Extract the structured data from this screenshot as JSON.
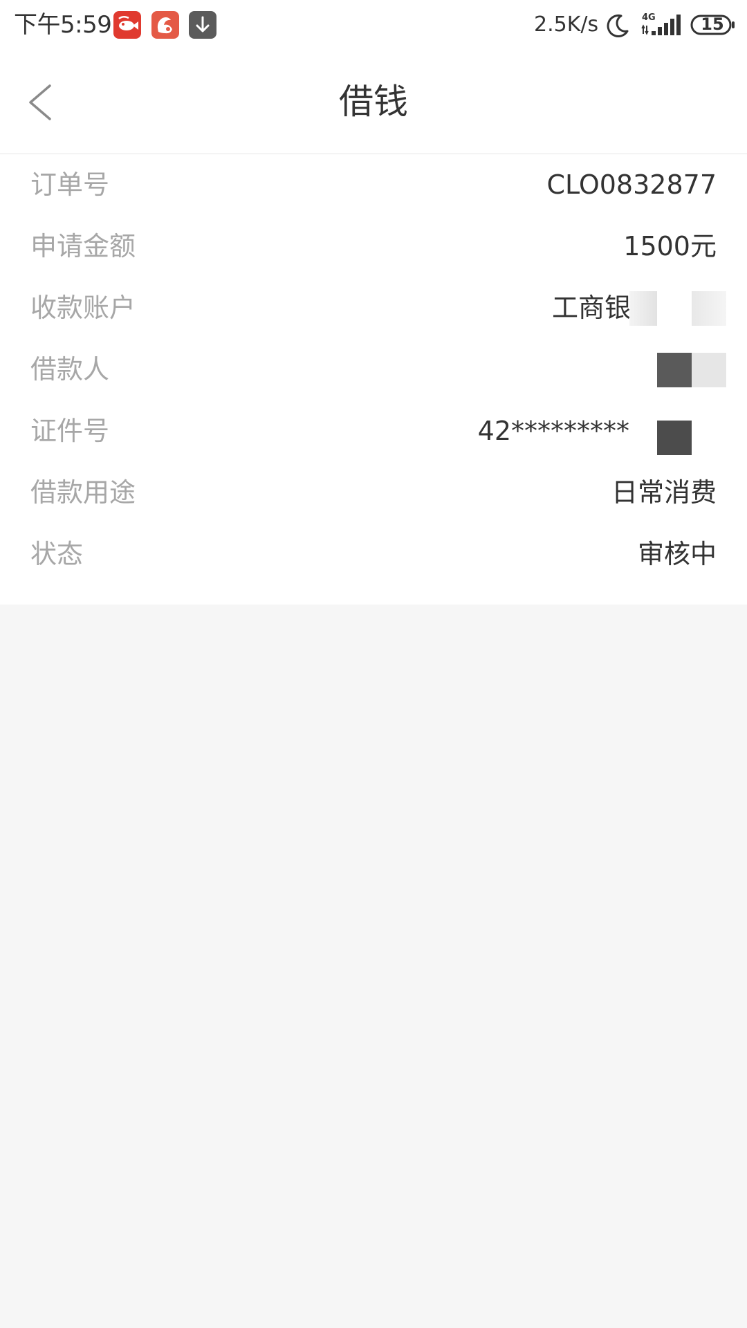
{
  "status_bar": {
    "time": "下午5:59",
    "network_speed": "2.5K/s",
    "network_type": "4G",
    "battery_level": "15",
    "app_icons": [
      "fish-app-icon",
      "uc-browser-icon",
      "download-icon"
    ],
    "colors": {
      "fish_app": "#e03a2f",
      "uc_browser": "#e45a46",
      "download": "#5b5b5b"
    }
  },
  "nav": {
    "title": "借钱",
    "back_icon": "chevron-left-icon"
  },
  "details": {
    "rows": [
      {
        "label": "订单号",
        "value": "CLO0832877"
      },
      {
        "label": "申请金额",
        "value": "1500元"
      },
      {
        "label": "收款账户",
        "value": "工商银行"
      },
      {
        "label": "借款人",
        "value": ""
      },
      {
        "label": "证件号",
        "value": "42*********"
      },
      {
        "label": "借款用途",
        "value": "日常消费"
      },
      {
        "label": "状态",
        "value": "审核中"
      }
    ]
  },
  "colors": {
    "label_text": "#a7a7a7",
    "value_text": "#333333",
    "page_background": "#f6f6f6",
    "card_background": "#ffffff"
  }
}
